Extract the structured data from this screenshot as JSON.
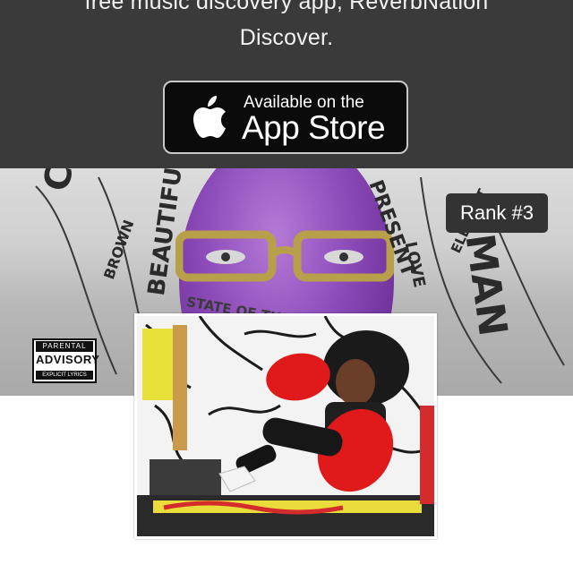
{
  "promo": {
    "line1": "free music discovery app, ReverbNation",
    "line2": "Discover."
  },
  "app_store_badge": {
    "small_text": "Available on the",
    "big_text": "App Store",
    "icon": "apple-icon"
  },
  "banner": {
    "artwork_words": [
      "CHARM",
      "BROWN",
      "BEAUTIFUL",
      "STATE OF THE ARTIST",
      "PRESENT",
      "LOVE",
      "ELEGANT",
      "MAN"
    ],
    "advisory": {
      "line1": "PARENTAL",
      "line2": "ADVISORY",
      "line3": "EXPLICIT LYRICS"
    }
  },
  "rank_badge": "Rank #3",
  "colors": {
    "top_bar": "#3a3a3a",
    "badge_bg": "#333333",
    "accent_red": "#e01a1a"
  }
}
